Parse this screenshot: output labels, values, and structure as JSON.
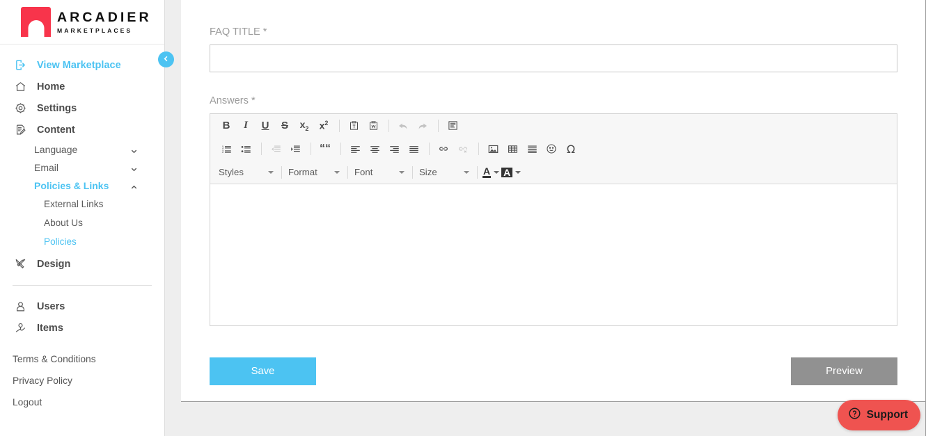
{
  "brand": {
    "name": "ARCADIER",
    "tagline": "MARKETPLACES",
    "logo_color": "#f8344b"
  },
  "theme": {
    "accent": "#4cc3f2",
    "save_button": "#4cc3f2",
    "preview_button": "#919191",
    "support_button": "#ef5350",
    "page_background": "#eeeeee"
  },
  "sidebar": {
    "toggle_icon": "chevron-left-icon",
    "items": [
      {
        "label": "View Marketplace",
        "icon": "login-arrow-icon",
        "active": true
      },
      {
        "label": "Home",
        "icon": "home-icon",
        "active": false
      },
      {
        "label": "Settings",
        "icon": "gear-icon",
        "active": false
      },
      {
        "label": "Content",
        "icon": "content-edit-icon",
        "active": false
      }
    ],
    "content_children": [
      {
        "label": "Language",
        "chevron": "chevron-down-icon",
        "expanded": false,
        "active": false
      },
      {
        "label": "Email",
        "chevron": "chevron-down-icon",
        "expanded": false,
        "active": false
      },
      {
        "label": "Policies & Links",
        "chevron": "chevron-up-icon",
        "expanded": true,
        "active": true
      }
    ],
    "policies_children": [
      {
        "label": "External Links",
        "active": false
      },
      {
        "label": "About Us",
        "active": false
      },
      {
        "label": "Policies",
        "active": true
      }
    ],
    "design": {
      "label": "Design",
      "icon": "design-tools-icon"
    },
    "lower_items": [
      {
        "label": "Users",
        "icon": "user-icon"
      },
      {
        "label": "Items",
        "icon": "items-box-icon"
      }
    ],
    "footer_links": [
      {
        "label": "Terms & Conditions"
      },
      {
        "label": "Privacy Policy"
      },
      {
        "label": "Logout"
      }
    ]
  },
  "form": {
    "faq_title": {
      "label": "FAQ TITLE *",
      "value": "",
      "placeholder": ""
    },
    "answers": {
      "label": "Answers *",
      "value": "",
      "placeholder": ""
    }
  },
  "editor": {
    "row1": [
      {
        "name": "bold-icon",
        "glyph": "B",
        "style": "b",
        "disabled": false
      },
      {
        "name": "italic-icon",
        "glyph": "I",
        "style": "i",
        "disabled": false
      },
      {
        "name": "underline-icon",
        "glyph": "U",
        "style": "u",
        "disabled": false
      },
      {
        "name": "strikethrough-icon",
        "glyph": "S",
        "style": "s",
        "disabled": false
      },
      {
        "name": "subscript-icon",
        "glyph": "x",
        "style": "sub",
        "disabled": false
      },
      {
        "name": "superscript-icon",
        "glyph": "x",
        "style": "sup",
        "disabled": false
      },
      {
        "name": "paste-as-text-icon",
        "glyph": "",
        "style": "svg",
        "disabled": false
      },
      {
        "name": "paste-from-word-icon",
        "glyph": "",
        "style": "svg",
        "disabled": false
      },
      {
        "name": "undo-icon",
        "glyph": "",
        "style": "svg",
        "disabled": true
      },
      {
        "name": "redo-icon",
        "glyph": "",
        "style": "svg",
        "disabled": true
      },
      {
        "name": "show-blocks-icon",
        "glyph": "",
        "style": "svg",
        "disabled": false
      }
    ],
    "row2": [
      {
        "name": "numbered-list-icon",
        "disabled": false
      },
      {
        "name": "bulleted-list-icon",
        "disabled": false
      },
      {
        "name": "outdent-icon",
        "disabled": true
      },
      {
        "name": "indent-icon",
        "disabled": false
      },
      {
        "name": "blockquote-icon",
        "disabled": false
      },
      {
        "name": "align-left-icon",
        "disabled": false
      },
      {
        "name": "align-center-icon",
        "disabled": false
      },
      {
        "name": "align-right-icon",
        "disabled": false
      },
      {
        "name": "align-justify-icon",
        "disabled": false
      },
      {
        "name": "link-icon",
        "disabled": false
      },
      {
        "name": "unlink-icon",
        "disabled": true
      },
      {
        "name": "image-icon",
        "disabled": false
      },
      {
        "name": "table-icon",
        "disabled": false
      },
      {
        "name": "horizontal-rule-icon",
        "disabled": false
      },
      {
        "name": "smiley-icon",
        "disabled": false
      },
      {
        "name": "special-character-icon",
        "disabled": false
      }
    ],
    "dropdowns": [
      {
        "label": "Styles",
        "name": "styles-dropdown"
      },
      {
        "label": "Format",
        "name": "format-dropdown"
      },
      {
        "label": "Font",
        "name": "font-dropdown"
      },
      {
        "label": "Size",
        "name": "size-dropdown"
      }
    ],
    "color_buttons": [
      {
        "label": "A",
        "name": "text-color-dropdown"
      },
      {
        "label": "A",
        "name": "background-color-dropdown"
      }
    ]
  },
  "actions": {
    "save": "Save",
    "preview": "Preview"
  },
  "support": {
    "label": "Support",
    "icon": "question-circle-icon"
  }
}
